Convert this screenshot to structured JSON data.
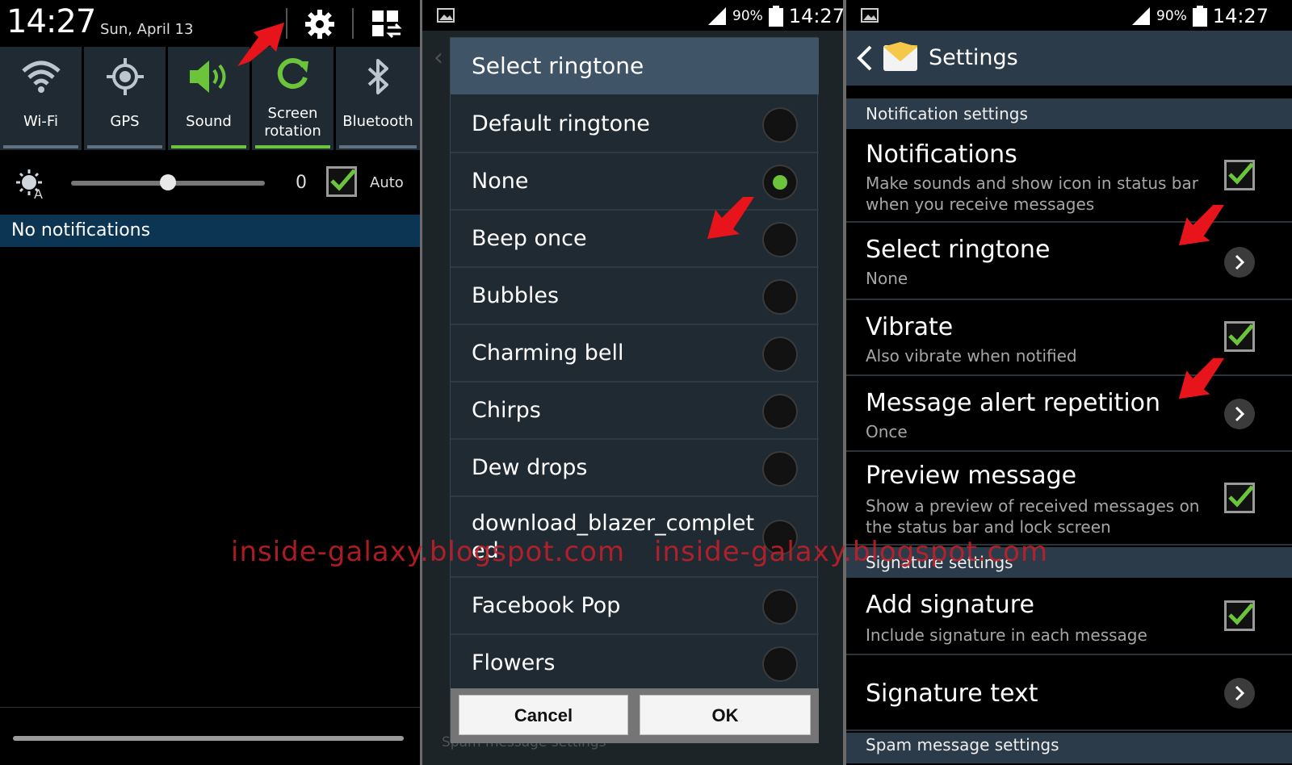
{
  "panel1": {
    "time": "14:27",
    "date": "Sun, April 13",
    "quick_settings": [
      {
        "label": "Wi-Fi",
        "icon": "wifi-icon",
        "active": false
      },
      {
        "label": "GPS",
        "icon": "gps-icon",
        "active": false
      },
      {
        "label": "Sound",
        "icon": "sound-icon",
        "active": true
      },
      {
        "label": "Screen rotation",
        "icon": "screen-rotation-icon",
        "active": true
      },
      {
        "label": "Bluetooth",
        "icon": "bluetooth-icon",
        "active": false
      }
    ],
    "brightness_value": "0",
    "brightness_level_fraction": 0.5,
    "auto_label": "Auto",
    "auto_checked": true,
    "no_notifications": "No notifications"
  },
  "panel2": {
    "battery": "90%",
    "time": "14:27",
    "dialog_title": "Select ringtone",
    "ringtones": [
      {
        "label": "Default ringtone",
        "selected": false
      },
      {
        "label": "None",
        "selected": true
      },
      {
        "label": "Beep once",
        "selected": false
      },
      {
        "label": "Bubbles",
        "selected": false
      },
      {
        "label": "Charming bell",
        "selected": false
      },
      {
        "label": "Chirps",
        "selected": false
      },
      {
        "label": "Dew drops",
        "selected": false
      },
      {
        "label": "download_blazer_completed",
        "selected": false
      },
      {
        "label": "Facebook Pop",
        "selected": false
      },
      {
        "label": "Flowers",
        "selected": false
      }
    ],
    "cancel_label": "Cancel",
    "ok_label": "OK",
    "ghost_bottom": "Spam message settings"
  },
  "panel3": {
    "battery": "90%",
    "time": "14:27",
    "title": "Settings",
    "section_notification": "Notification settings",
    "section_signature": "Signature settings",
    "section_spam": "Spam message settings",
    "items": {
      "notifications": {
        "title": "Notifications",
        "summary": "Make sounds and show icon in status bar when you receive messages",
        "checked": true
      },
      "select_ringtone": {
        "title": "Select ringtone",
        "summary": "None"
      },
      "vibrate": {
        "title": "Vibrate",
        "summary": "Also vibrate when notified",
        "checked": true
      },
      "alert_repetition": {
        "title": "Message alert repetition",
        "summary": "Once"
      },
      "preview": {
        "title": "Preview message",
        "summary": "Show a preview of received messages on the status bar and lock screen",
        "checked": true
      },
      "add_signature": {
        "title": "Add signature",
        "summary": "Include signature in each message",
        "checked": true
      },
      "signature_text": {
        "title": "Signature text"
      }
    }
  },
  "watermark": "inside-galaxy.blogspot.com",
  "colors": {
    "accent_green": "#6cc43a",
    "section_bar": "#2c3b49",
    "dialog_title_bg": "#3f5467",
    "watermark_red": "#c31f2a",
    "arrow_red": "#e8141c"
  }
}
